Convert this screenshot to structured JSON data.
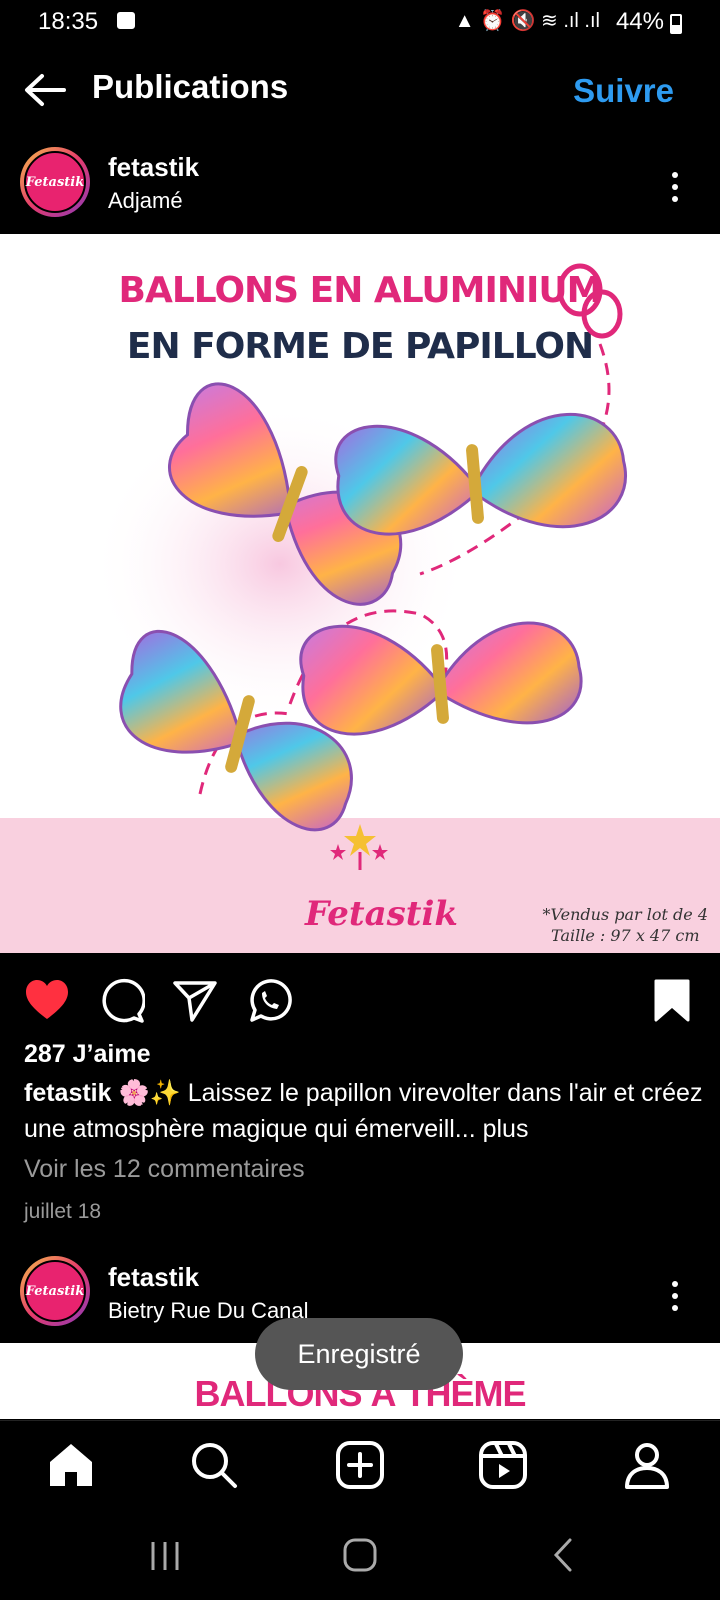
{
  "status_bar": {
    "time": "18:35",
    "battery": "44%",
    "icons": "▲ ⏰ 🔇 ≋ .ıl .ıl"
  },
  "header": {
    "title": "Publications",
    "follow": "Suivre"
  },
  "post": {
    "username": "fetastik",
    "location": "Adjamé",
    "avatar_text": "Fetastik",
    "image": {
      "line1": "BALLONS EN ALUMINIUM",
      "line2": "EN FORME DE PAPILLON",
      "logo": "Fetastik",
      "note_line1": "*Vendus par lot de 4",
      "note_line2": "Taille : 97 x 47 cm"
    },
    "likes": "287 J’aime",
    "caption_user": "fetastik",
    "caption_text": " 🌸✨ Laissez le papillon virevolter dans l'air et créez une atmosphère magique qui émerveill...",
    "caption_more": " plus",
    "comments_link": "Voir les 12 commentaires",
    "date": "juillet 18",
    "liked": true,
    "saved": true
  },
  "next_post": {
    "username": "fetastik",
    "location": "Bietry Rue Du Canal",
    "avatar_text": "Fetastik",
    "image_title": "BALLONS À THÈME"
  },
  "toast": "Enregistré",
  "bottom_nav": [
    "home-icon",
    "search-icon",
    "create-icon",
    "reels-icon",
    "profile-icon"
  ],
  "colors": {
    "accent": "#2e9bf0",
    "like": "#ff3040",
    "brand_pink": "#e0287a"
  }
}
